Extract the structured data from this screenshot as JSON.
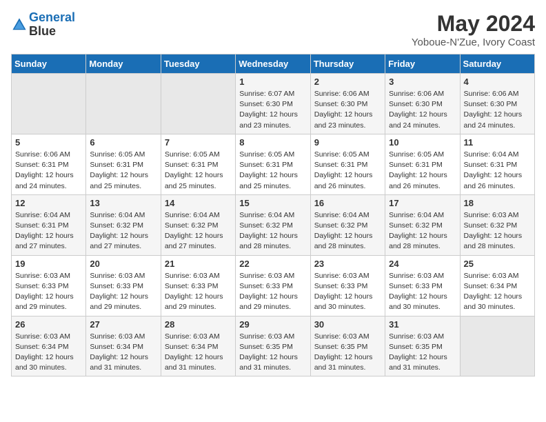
{
  "header": {
    "logo_line1": "General",
    "logo_line2": "Blue",
    "title": "May 2024",
    "subtitle": "Yoboue-N'Zue, Ivory Coast"
  },
  "weekdays": [
    "Sunday",
    "Monday",
    "Tuesday",
    "Wednesday",
    "Thursday",
    "Friday",
    "Saturday"
  ],
  "weeks": [
    [
      {
        "day": "",
        "info": ""
      },
      {
        "day": "",
        "info": ""
      },
      {
        "day": "",
        "info": ""
      },
      {
        "day": "1",
        "info": "Sunrise: 6:07 AM\nSunset: 6:30 PM\nDaylight: 12 hours\nand 23 minutes."
      },
      {
        "day": "2",
        "info": "Sunrise: 6:06 AM\nSunset: 6:30 PM\nDaylight: 12 hours\nand 23 minutes."
      },
      {
        "day": "3",
        "info": "Sunrise: 6:06 AM\nSunset: 6:30 PM\nDaylight: 12 hours\nand 24 minutes."
      },
      {
        "day": "4",
        "info": "Sunrise: 6:06 AM\nSunset: 6:30 PM\nDaylight: 12 hours\nand 24 minutes."
      }
    ],
    [
      {
        "day": "5",
        "info": "Sunrise: 6:06 AM\nSunset: 6:31 PM\nDaylight: 12 hours\nand 24 minutes."
      },
      {
        "day": "6",
        "info": "Sunrise: 6:05 AM\nSunset: 6:31 PM\nDaylight: 12 hours\nand 25 minutes."
      },
      {
        "day": "7",
        "info": "Sunrise: 6:05 AM\nSunset: 6:31 PM\nDaylight: 12 hours\nand 25 minutes."
      },
      {
        "day": "8",
        "info": "Sunrise: 6:05 AM\nSunset: 6:31 PM\nDaylight: 12 hours\nand 25 minutes."
      },
      {
        "day": "9",
        "info": "Sunrise: 6:05 AM\nSunset: 6:31 PM\nDaylight: 12 hours\nand 26 minutes."
      },
      {
        "day": "10",
        "info": "Sunrise: 6:05 AM\nSunset: 6:31 PM\nDaylight: 12 hours\nand 26 minutes."
      },
      {
        "day": "11",
        "info": "Sunrise: 6:04 AM\nSunset: 6:31 PM\nDaylight: 12 hours\nand 26 minutes."
      }
    ],
    [
      {
        "day": "12",
        "info": "Sunrise: 6:04 AM\nSunset: 6:31 PM\nDaylight: 12 hours\nand 27 minutes."
      },
      {
        "day": "13",
        "info": "Sunrise: 6:04 AM\nSunset: 6:32 PM\nDaylight: 12 hours\nand 27 minutes."
      },
      {
        "day": "14",
        "info": "Sunrise: 6:04 AM\nSunset: 6:32 PM\nDaylight: 12 hours\nand 27 minutes."
      },
      {
        "day": "15",
        "info": "Sunrise: 6:04 AM\nSunset: 6:32 PM\nDaylight: 12 hours\nand 28 minutes."
      },
      {
        "day": "16",
        "info": "Sunrise: 6:04 AM\nSunset: 6:32 PM\nDaylight: 12 hours\nand 28 minutes."
      },
      {
        "day": "17",
        "info": "Sunrise: 6:04 AM\nSunset: 6:32 PM\nDaylight: 12 hours\nand 28 minutes."
      },
      {
        "day": "18",
        "info": "Sunrise: 6:03 AM\nSunset: 6:32 PM\nDaylight: 12 hours\nand 28 minutes."
      }
    ],
    [
      {
        "day": "19",
        "info": "Sunrise: 6:03 AM\nSunset: 6:33 PM\nDaylight: 12 hours\nand 29 minutes."
      },
      {
        "day": "20",
        "info": "Sunrise: 6:03 AM\nSunset: 6:33 PM\nDaylight: 12 hours\nand 29 minutes."
      },
      {
        "day": "21",
        "info": "Sunrise: 6:03 AM\nSunset: 6:33 PM\nDaylight: 12 hours\nand 29 minutes."
      },
      {
        "day": "22",
        "info": "Sunrise: 6:03 AM\nSunset: 6:33 PM\nDaylight: 12 hours\nand 29 minutes."
      },
      {
        "day": "23",
        "info": "Sunrise: 6:03 AM\nSunset: 6:33 PM\nDaylight: 12 hours\nand 30 minutes."
      },
      {
        "day": "24",
        "info": "Sunrise: 6:03 AM\nSunset: 6:33 PM\nDaylight: 12 hours\nand 30 minutes."
      },
      {
        "day": "25",
        "info": "Sunrise: 6:03 AM\nSunset: 6:34 PM\nDaylight: 12 hours\nand 30 minutes."
      }
    ],
    [
      {
        "day": "26",
        "info": "Sunrise: 6:03 AM\nSunset: 6:34 PM\nDaylight: 12 hours\nand 30 minutes."
      },
      {
        "day": "27",
        "info": "Sunrise: 6:03 AM\nSunset: 6:34 PM\nDaylight: 12 hours\nand 31 minutes."
      },
      {
        "day": "28",
        "info": "Sunrise: 6:03 AM\nSunset: 6:34 PM\nDaylight: 12 hours\nand 31 minutes."
      },
      {
        "day": "29",
        "info": "Sunrise: 6:03 AM\nSunset: 6:35 PM\nDaylight: 12 hours\nand 31 minutes."
      },
      {
        "day": "30",
        "info": "Sunrise: 6:03 AM\nSunset: 6:35 PM\nDaylight: 12 hours\nand 31 minutes."
      },
      {
        "day": "31",
        "info": "Sunrise: 6:03 AM\nSunset: 6:35 PM\nDaylight: 12 hours\nand 31 minutes."
      },
      {
        "day": "",
        "info": ""
      }
    ]
  ]
}
